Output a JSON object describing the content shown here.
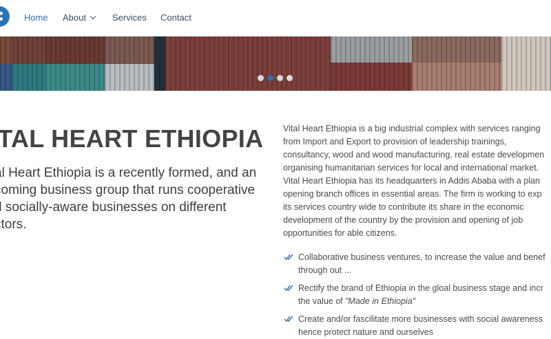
{
  "nav": {
    "items": [
      {
        "label": "Home",
        "active": true
      },
      {
        "label": "About",
        "has_dropdown": true
      },
      {
        "label": "Services"
      },
      {
        "label": "Contact"
      }
    ]
  },
  "hero": {
    "slides": 4,
    "active_slide": 2
  },
  "intro": {
    "title": "ITAL HEART ETHIOPIA",
    "lead_lines": [
      "al Heart Ethiopia is a recently formed, and an",
      "coming business group that runs cooperative",
      "d socially-aware businesses on different",
      "ctors."
    ]
  },
  "about": {
    "paragraph_lines": [
      "Vital Heart Ethiopia is a big industrial complex with services ranging",
      "from Import and Export to provision of leadership trainings,",
      "consultancy, wood and wood manufacturing, real estate developmen",
      "organising humanitarian services for local and international market.",
      "Vital Heart Ethiopia has its headquarters in Addis Ababa with a plan",
      "opening branch offices in essential areas. The firm is working to exp",
      "its services country wide to contribute its share in the economic",
      "development of the country by the provision and opening of job",
      "opportunities for able citizens."
    ],
    "features": [
      {
        "icon": "double-check-icon",
        "line1": "Collaborative business ventures, to increase the value and benef",
        "line2": "through out ..."
      },
      {
        "icon": "double-check-icon",
        "line1": "Rectify the brand of Ethiopia in the gloal business stage and incr",
        "line2_prefix": "the value of ",
        "line2_em": "\"Made in Ethiopia\""
      },
      {
        "icon": "double-check-icon",
        "line1": "Create and/or fascilitate more businesses with social awareness",
        "line2": "hence protect nature and ourselves"
      }
    ]
  },
  "colors": {
    "accent": "#2f6fb2",
    "nav_text": "#3b4d66",
    "heading": "#444444",
    "body_text": "#4a4a4a"
  }
}
